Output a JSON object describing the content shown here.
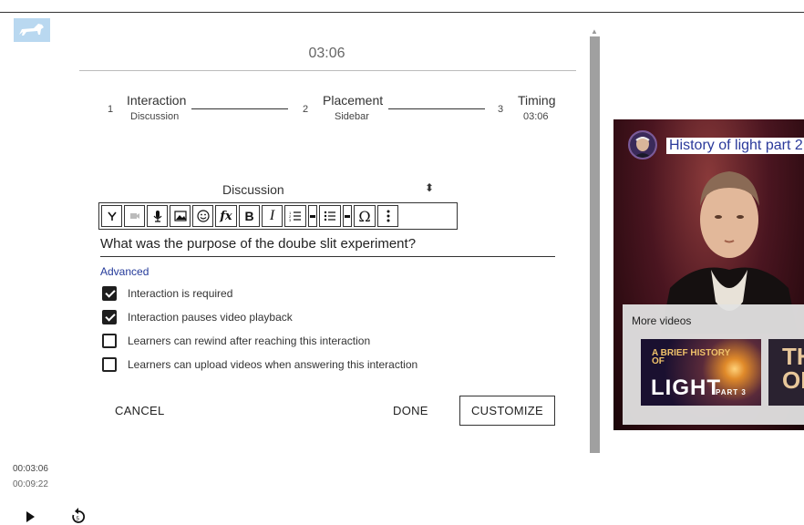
{
  "header": {
    "time": "03:06"
  },
  "stepper": [
    {
      "num": "1",
      "title": "Interaction",
      "sub": "Discussion"
    },
    {
      "num": "2",
      "title": "Placement",
      "sub": "Sidebar"
    },
    {
      "num": "3",
      "title": "Timing",
      "sub": "03:06"
    }
  ],
  "interaction_select": {
    "value": "Discussion"
  },
  "toolbar": {
    "items": [
      "branch-icon",
      "video-icon",
      "microphone-icon",
      "image-icon",
      "emoji-icon",
      "formula-icon",
      "bold-icon",
      "italic-icon",
      "ordered-list-icon",
      "dropdown-caret",
      "unordered-list-icon",
      "dropdown-caret",
      "omega-icon",
      "more-vertical-icon"
    ],
    "formula": "fx",
    "bold": "B",
    "italic": "I",
    "omega": "Ω"
  },
  "question": {
    "text": "What was the purpose of the doube slit experiment?"
  },
  "advanced": {
    "label": "Advanced"
  },
  "options": [
    {
      "label": "Interaction is required",
      "checked": true
    },
    {
      "label": "Interaction pauses video playback",
      "checked": true
    },
    {
      "label": "Learners can rewind after reaching this interaction",
      "checked": false
    },
    {
      "label": "Learners can upload videos when answering this interaction",
      "checked": false
    }
  ],
  "actions": {
    "cancel": "CANCEL",
    "done": "DONE",
    "customize": "CUSTOMIZE"
  },
  "video": {
    "title": "History of light part 2",
    "more_videos_label": "More videos",
    "thumb1": {
      "line1": "A BRIEF HISTORY OF",
      "line2": "LIGHT",
      "line3": "PART 3"
    },
    "thumb2": {
      "text": "THE OF"
    }
  },
  "player": {
    "current_time": "00:03:06",
    "duration": "00:09:22"
  },
  "colors": {
    "accent_link": "#243a9a",
    "video_title": "#2b3a9b",
    "scrollbar": "#a0a0a0"
  }
}
